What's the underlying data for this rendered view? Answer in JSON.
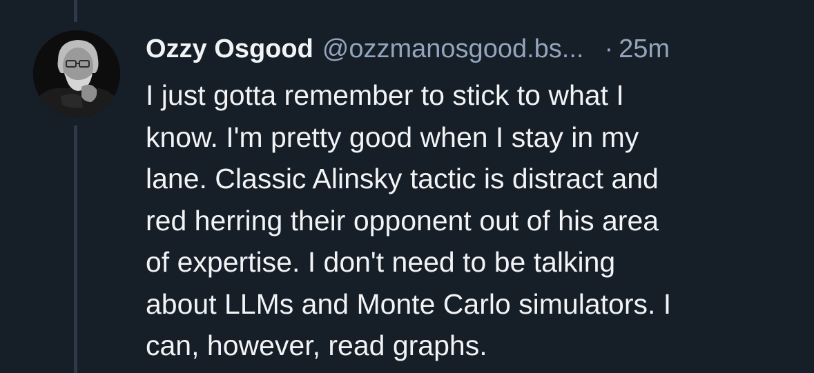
{
  "post": {
    "author": {
      "display_name": "Ozzy Osgood",
      "handle": "@ozzmanosgood.bs..."
    },
    "separator": "·",
    "timestamp": "25m",
    "text_lines": [
      "I just gotta remember to stick to what I",
      "know. I'm pretty good when I stay in my",
      "lane. Classic Alinsky tactic is distract and",
      "red herring their opponent out of his area",
      "of expertise. I don't need to be talking",
      "about LLMs and Monte Carlo simulators. I",
      "can, however, read graphs."
    ]
  },
  "colors": {
    "background": "#161e27",
    "primary_text": "#f1f3f5",
    "secondary_text": "#93a5bd",
    "thread_line": "#2e3a4b"
  }
}
